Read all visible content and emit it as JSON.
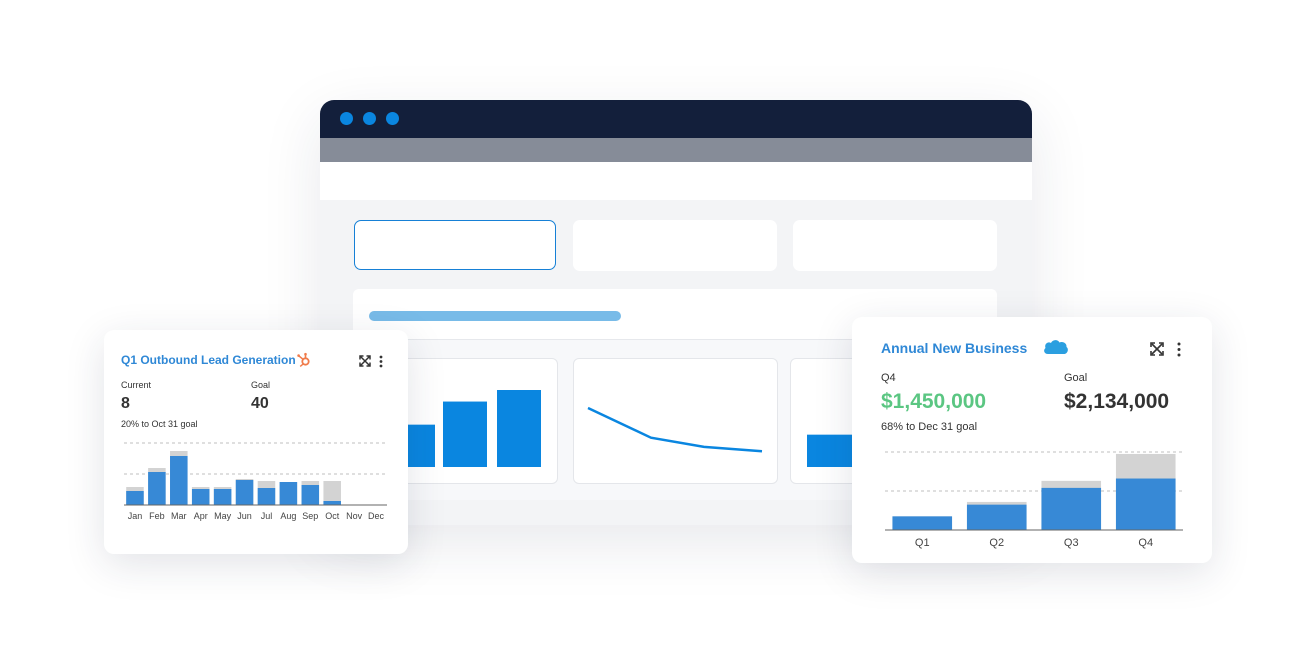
{
  "colors": {
    "accent": "#2f88d6",
    "bar_blue": "#3789d6",
    "goal_grey": "#d3d3d3",
    "dark_header": "#131f3b",
    "positive_green": "#5bc682"
  },
  "browser": {
    "mini_bar_values": [
      0.55,
      0.85,
      1.0
    ],
    "mini_line_values": [
      1.0,
      0.45,
      0.28,
      0.2
    ],
    "mini_third_value": 0.42
  },
  "lead_card": {
    "title": "Q1 Outbound Lead Generation",
    "integration_icon": "hubspot-icon",
    "current_label": "Current",
    "current_value": "8",
    "goal_label": "Goal",
    "goal_value": "40",
    "progress_text": "20% to Oct 31 goal"
  },
  "business_card": {
    "title": "Annual New Business",
    "integration_icon": "salesforce-icon",
    "current_label": "Q4",
    "current_value": "$1,450,000",
    "goal_label": "Goal",
    "goal_value": "$2,134,000",
    "progress_text": "68% to Dec 31 goal"
  },
  "chart_data": [
    {
      "type": "bar",
      "categories": [
        "Jan",
        "Feb",
        "Mar",
        "Apr",
        "May",
        "Jun",
        "Jul",
        "Aug",
        "Sep",
        "Oct",
        "Nov",
        "Dec"
      ],
      "series": [
        {
          "values": [
            14,
            33,
            49,
            16,
            16,
            25,
            17,
            23,
            20,
            4,
            0,
            0
          ]
        },
        {
          "values": [
            18,
            37,
            54,
            18,
            18,
            26,
            24,
            23,
            24,
            24,
            0,
            0
          ]
        }
      ],
      "ylim": [
        0,
        62
      ],
      "grid": true
    },
    {
      "type": "bar",
      "categories": [
        "Q1",
        "Q2",
        "Q3",
        "Q4"
      ],
      "series": [
        {
          "values": [
            350000,
            650000,
            1080000,
            1320000
          ]
        },
        {
          "values": [
            350000,
            720000,
            1260000,
            1950000
          ]
        }
      ],
      "ylim": [
        0,
        2000000
      ],
      "grid": true
    }
  ]
}
